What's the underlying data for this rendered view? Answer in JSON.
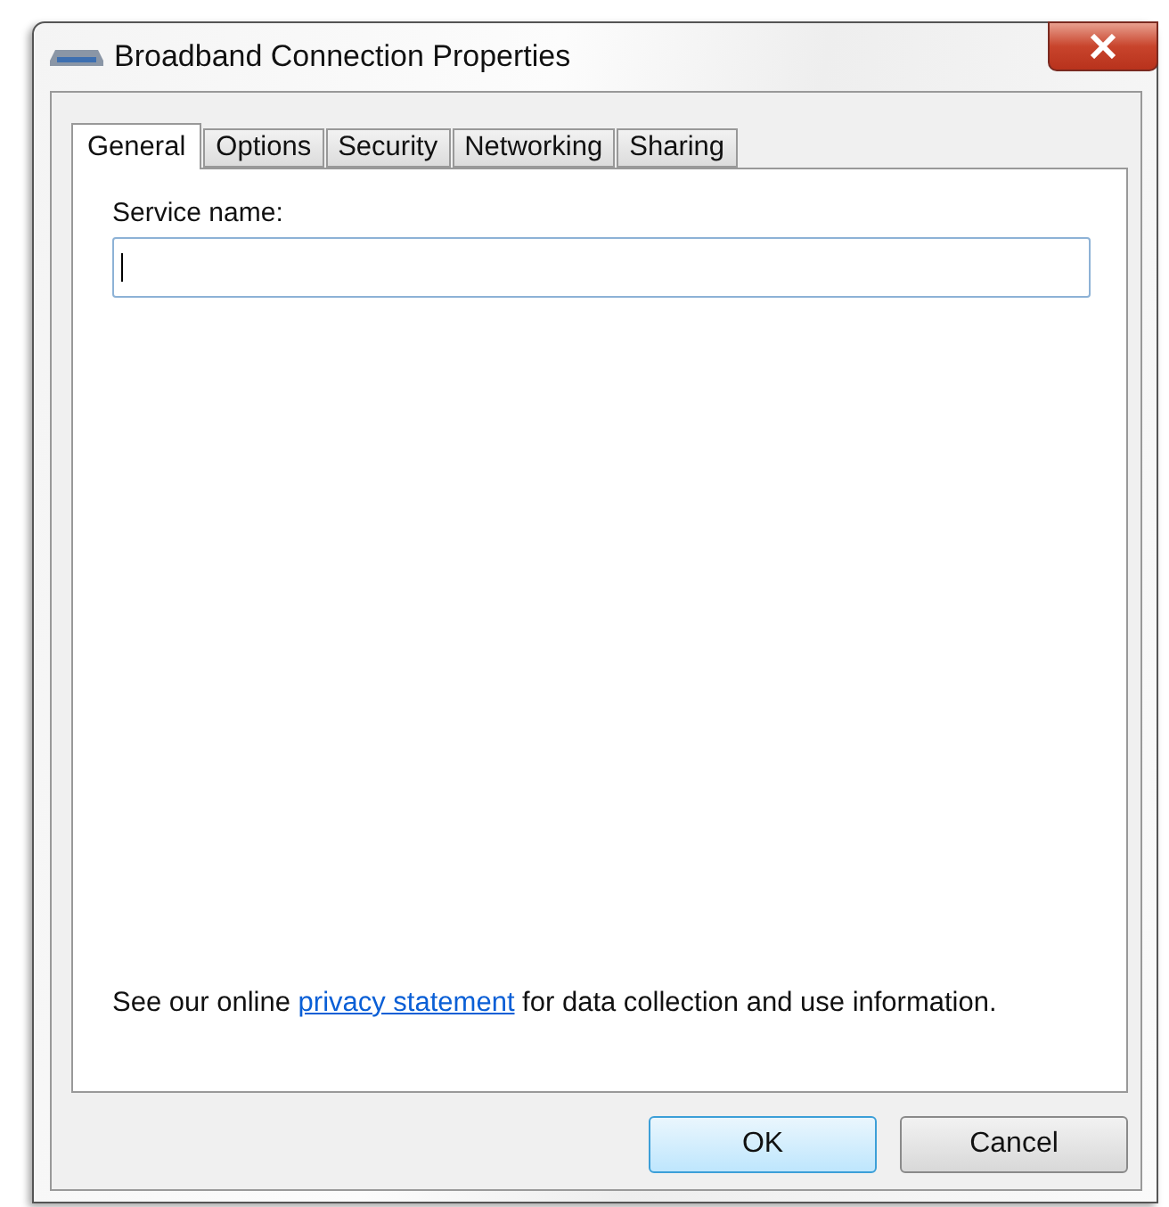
{
  "window": {
    "title": "Broadband Connection Properties"
  },
  "tabs": [
    {
      "label": "General",
      "selected": true
    },
    {
      "label": "Options",
      "selected": false
    },
    {
      "label": "Security",
      "selected": false
    },
    {
      "label": "Networking",
      "selected": false
    },
    {
      "label": "Sharing",
      "selected": false
    }
  ],
  "service_name": {
    "label": "Service name:",
    "focused": true
  },
  "privacy": {
    "before": "See our online ",
    "link": "privacy statement",
    "after": " for data collection and use information."
  },
  "buttons": [
    {
      "label": "OK",
      "default": true
    },
    {
      "label": "Cancel",
      "default": false
    }
  ]
}
